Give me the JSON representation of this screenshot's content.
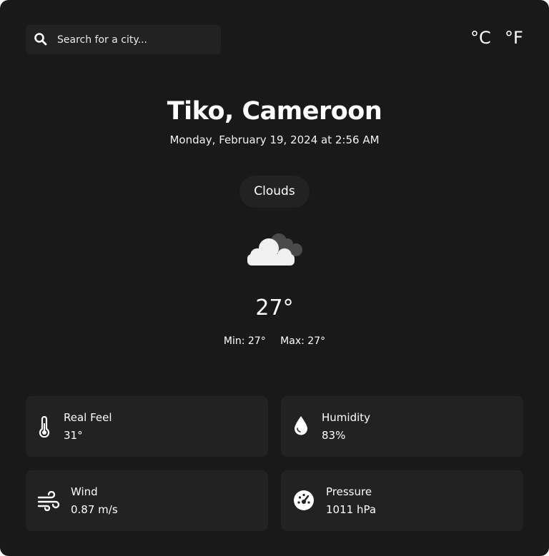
{
  "search": {
    "placeholder": "Search for a city..."
  },
  "units": {
    "celsius": "°C",
    "fahrenheit": "°F"
  },
  "location": {
    "city": "Tiko, Cameroon",
    "datetime": "Monday, February 19, 2024 at 2:56 AM"
  },
  "weather": {
    "condition": "Clouds",
    "icon": "clouds-icon",
    "temperature": "27°",
    "min": "Min: 27°",
    "max": "Max: 27°"
  },
  "details": [
    {
      "label": "Real Feel",
      "value": "31°",
      "icon": "thermometer-icon"
    },
    {
      "label": "Humidity",
      "value": "83%",
      "icon": "droplet-icon"
    },
    {
      "label": "Wind",
      "value": "0.87 m/s",
      "icon": "wind-icon"
    },
    {
      "label": "Pressure",
      "value": "1011 hPa",
      "icon": "gauge-icon"
    }
  ],
  "colors": {
    "background": "#191919",
    "panel": "#222222",
    "text": "#ffffff"
  }
}
